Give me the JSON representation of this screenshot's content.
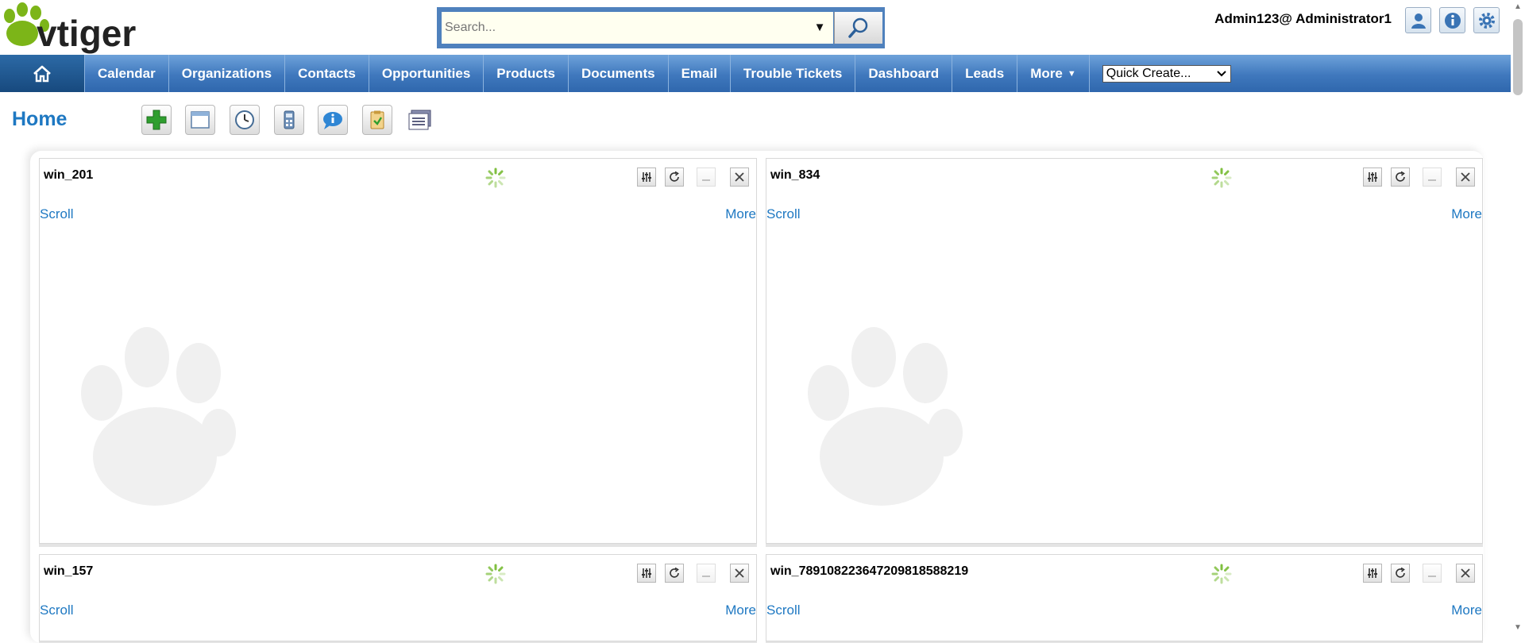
{
  "header": {
    "logo_text": "vtiger",
    "search_placeholder": "Search...",
    "user_label": "Admin123@ Administrator1",
    "icons": [
      "user-preferences-icon",
      "info-icon",
      "settings-gear-icon"
    ]
  },
  "nav": {
    "items": [
      "Calendar",
      "Organizations",
      "Contacts",
      "Opportunities",
      "Products",
      "Documents",
      "Email",
      "Trouble Tickets",
      "Dashboard",
      "Leads",
      "More"
    ],
    "quick_create": "Quick Create..."
  },
  "page": {
    "title": "Home",
    "toolbar_icons": [
      "add-widget-icon",
      "layout-icon",
      "clock-icon",
      "calculator-icon",
      "chat-icon",
      "clipboard-icon",
      "notebook-icon"
    ]
  },
  "widgets": [
    {
      "title": "win_201",
      "scroll_label": "Scroll",
      "more_label": "More"
    },
    {
      "title": "win_834",
      "scroll_label": "Scroll",
      "more_label": "More"
    },
    {
      "title": "win_157",
      "scroll_label": "Scroll",
      "more_label": "More"
    },
    {
      "title": "win_78910822364720981858821​9",
      "scroll_label": "Scroll",
      "more_label": "More"
    }
  ],
  "colors": {
    "nav_blue": "#3f78bd",
    "link_blue": "#1e78c2",
    "logo_green": "#7cb518",
    "search_border": "#4f81bd"
  }
}
